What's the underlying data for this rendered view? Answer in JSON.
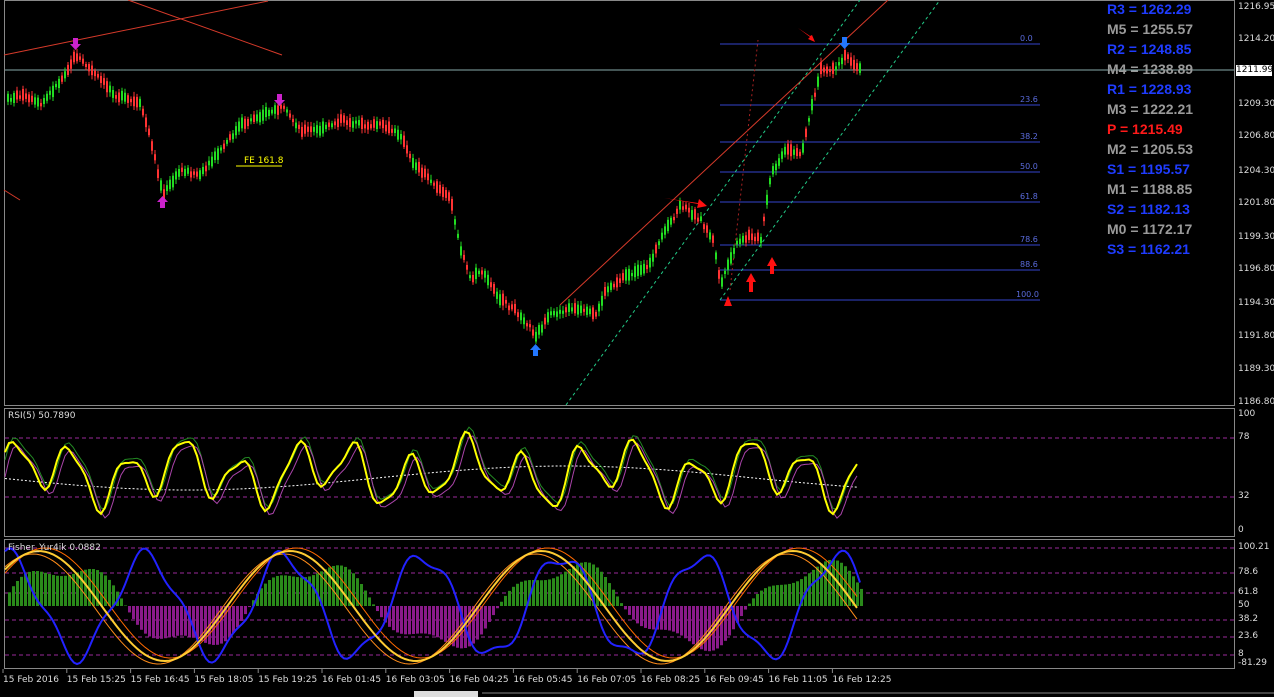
{
  "pivots": [
    {
      "label": "R3 = 1262.29",
      "color": "#1f3cff"
    },
    {
      "label": "M5 = 1255.57",
      "color": "#9a9a9a"
    },
    {
      "label": "R2 = 1248.85",
      "color": "#1f3cff"
    },
    {
      "label": "M4 = 1238.89",
      "color": "#9a9a9a"
    },
    {
      "label": "R1 = 1228.93",
      "color": "#1f3cff"
    },
    {
      "label": "M3 = 1222.21",
      "color": "#9a9a9a"
    },
    {
      "label": "P  = 1215.49",
      "color": "#ff1a1a"
    },
    {
      "label": "M2 = 1205.53",
      "color": "#9a9a9a"
    },
    {
      "label": "S1 = 1195.57",
      "color": "#1f3cff"
    },
    {
      "label": "M1 = 1188.85",
      "color": "#9a9a9a"
    },
    {
      "label": "S2 = 1182.13",
      "color": "#1f3cff"
    },
    {
      "label": "M0 = 1172.17",
      "color": "#9a9a9a"
    },
    {
      "label": "S3 = 1162.21",
      "color": "#1f3cff"
    }
  ],
  "price_axis": [
    "1216.95",
    "1214.20",
    "1209.30",
    "1206.80",
    "1204.30",
    "1201.80",
    "1199.30",
    "1196.80",
    "1194.30",
    "1191.80",
    "1189.30",
    "1186.80"
  ],
  "current_price": "1211.99",
  "fib_levels": [
    "0.0",
    "23.6",
    "38.2",
    "50.0",
    "61.8",
    "78.6",
    "88.6",
    "100.0"
  ],
  "fe_label": "FE 161.8",
  "rsi": {
    "title": "RSI(5) 50.7890",
    "axis": [
      "100",
      "78",
      "32",
      "0"
    ]
  },
  "fisher": {
    "title": "Fisher_Yur4ik 0.0882",
    "axis": [
      "100.21",
      "78.6",
      "61.8",
      "50",
      "38.2",
      "23.6",
      "8",
      "-81.29"
    ]
  },
  "time_axis": [
    "15 Feb 2016",
    "15 Feb 15:25",
    "15 Feb 16:45",
    "15 Feb 18:05",
    "15 Feb 19:25",
    "16 Feb 01:45",
    "16 Feb 03:05",
    "16 Feb 04:25",
    "16 Feb 05:45",
    "16 Feb 07:05",
    "16 Feb 08:25",
    "16 Feb 09:45",
    "16 Feb 11:05",
    "16 Feb 12:25"
  ],
  "colors": {
    "bull": "#22dd22",
    "bear": "#ff3333",
    "rsi": "#ffff00",
    "fisher_blue": "#2222ff"
  }
}
